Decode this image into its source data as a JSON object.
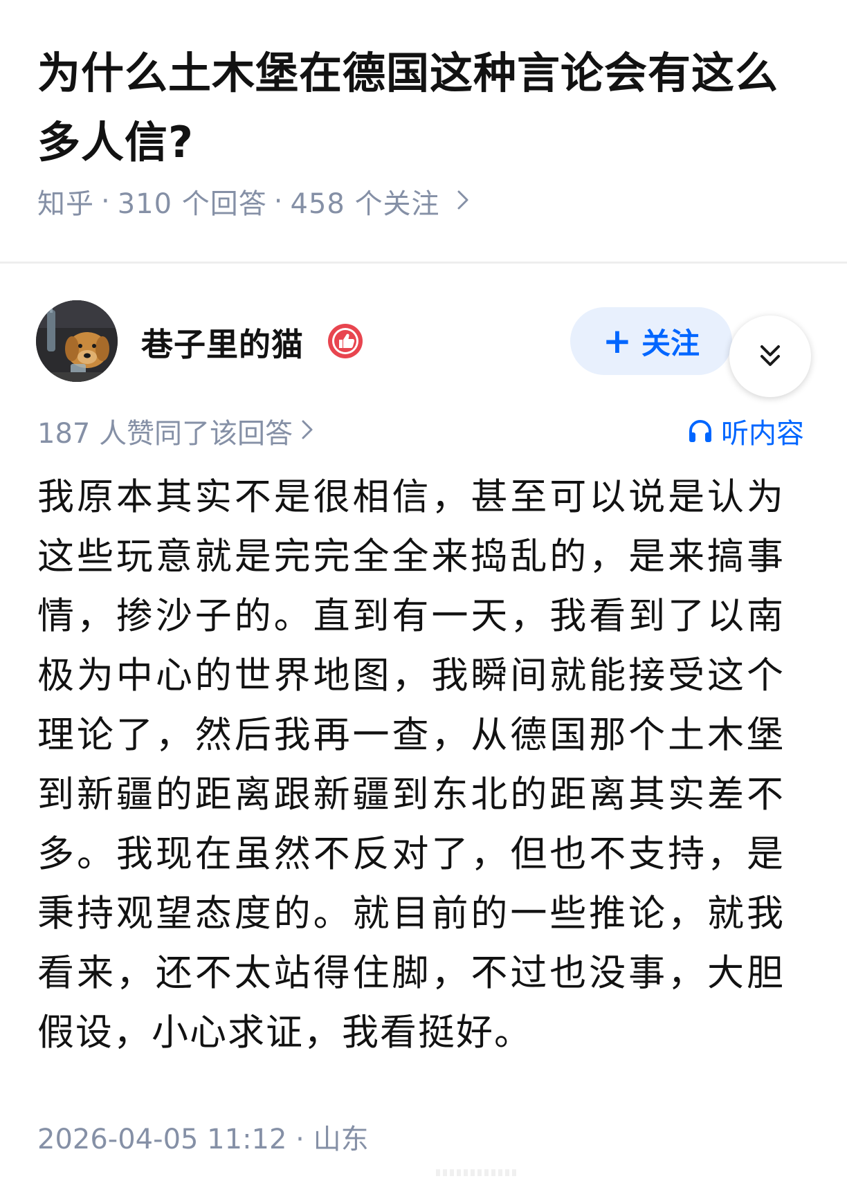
{
  "question": {
    "title": "为什么土木堡在德国这种言论会有这么多人信?",
    "platform": "知乎",
    "separator": "·",
    "answers_count": "310 个回答",
    "followers_count": "458 个关注",
    "chevron_icon": "chevron-right-icon"
  },
  "author": {
    "name": "巷子里的猫",
    "badge_icon": "thumbs-up-badge-icon",
    "avatar_icon": "dog-avatar",
    "follow_label": "关注",
    "follow_plus": "+",
    "expand_icon": "double-chevron-down-icon"
  },
  "answer": {
    "upvote_text": "187 人赞同了该回答",
    "listen_label": "听内容",
    "listen_icon": "headphones-icon",
    "body": "我原本其实不是很相信，甚至可以说是认为这些玩意就是完完全全来捣乱的，是来搞事情，掺沙子的。直到有一天，我看到了以南极为中心的世界地图，我瞬间就能接受这个理论了，然后我再一查，从德国那个土木堡到新疆的距离跟新疆到东北的距离其实差不多。我现在虽然不反对了，但也不支持，是秉持观望态度的。就目前的一些推论，就我看来，还不太站得住脚，不过也没事，大胆假设，小心求证，我看挺好。",
    "timestamp": "2026-04-05 11:12",
    "location": "山东"
  },
  "colors": {
    "accent": "#0066ff",
    "meta_gray": "#8590a6",
    "follow_bg": "#e8f0fd",
    "badge_red": "#e8454f"
  }
}
